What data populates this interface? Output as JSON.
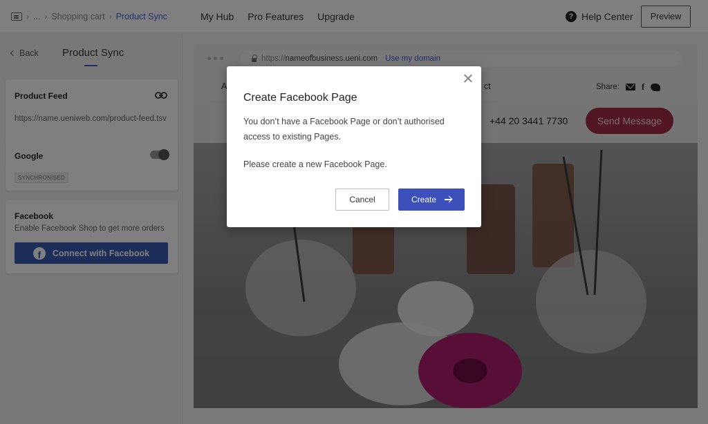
{
  "breadcrumb": {
    "icon": "chat-icon",
    "ellipsis": "...",
    "parent": "Shopping cart",
    "current": "Product Sync"
  },
  "topnav": {
    "items": [
      "My Hub",
      "Pro Features",
      "Upgrade"
    ],
    "help_label": "Help Center",
    "help_icon": "?",
    "preview_label": "Preview"
  },
  "sidebar": {
    "back_label": "Back",
    "title": "Product Sync",
    "product_feed": {
      "title": "Product Feed",
      "url": "https://name.ueniweb.com/product-feed.tsv",
      "icon": "link-icon"
    },
    "google": {
      "title": "Google",
      "toggle_on": true,
      "badge": "SYNCHRONISED"
    },
    "facebook": {
      "title": "Facebook",
      "description": "Enable Facebook Shop to get more orders",
      "button_label": "Connect with Facebook",
      "button_icon": "f"
    }
  },
  "preview": {
    "url_prefix": "https://",
    "url_domain": "nameofbusiness.ueni.com",
    "url_link": "Use my domain",
    "nav_fragment_left": "A",
    "nav_fragment_right": "ct",
    "share_label": "Share:",
    "share_fb": "f",
    "phone": "+44 20 3441 7730",
    "send_label": "Send Message"
  },
  "modal": {
    "title": "Create Facebook Page",
    "text1": "You don’t have a Facebook Page or don’t authorised access to existing Pages.",
    "text2": "Please create a new Facebook Page.",
    "cancel_label": "Cancel",
    "create_label": "Create"
  },
  "colors": {
    "accent": "#3c5fd1",
    "facebook_blue": "#3b5bb4",
    "create_button": "#3c4fbb",
    "send_button": "#a42a45"
  }
}
